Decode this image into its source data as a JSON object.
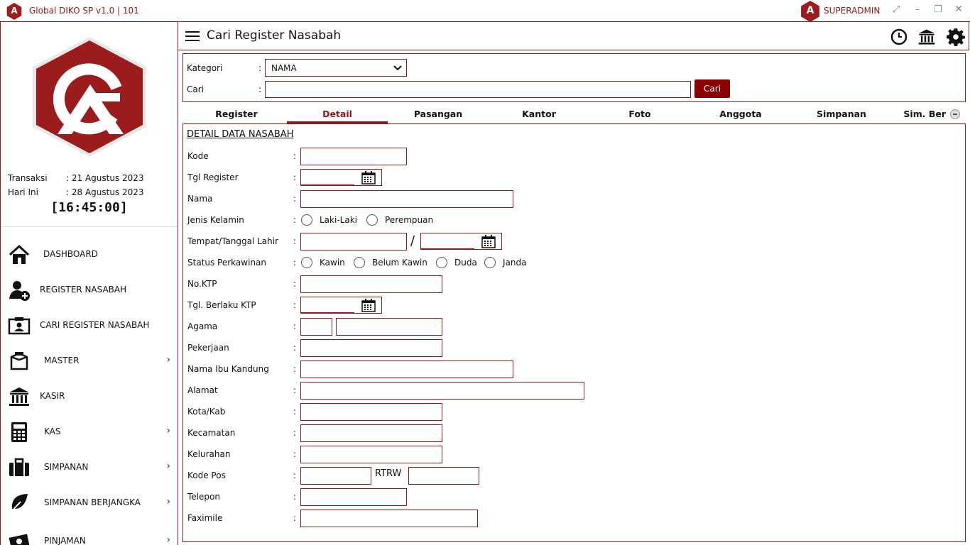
{
  "window": {
    "title": "Global DIKO SP v1.0 | 101",
    "user": "SUPERADMIN"
  },
  "sidebar": {
    "transaksi_label": "Transaksi",
    "transaksi_value": ": 21 Agustus 2023",
    "hari_ini_label": "Hari Ini",
    "hari_ini_value": ": 28 Agustus 2023",
    "clock": "[16:45:00]",
    "items": [
      {
        "label": "DASHBOARD",
        "icon": "home-icon"
      },
      {
        "label": "REGISTER NASABAH",
        "icon": "user-add-icon"
      },
      {
        "label": "CARI REGISTER NASABAH",
        "icon": "id-card-icon"
      },
      {
        "label": "MASTER",
        "icon": "box-icon"
      },
      {
        "label": "KASIR",
        "icon": "bank-icon"
      },
      {
        "label": "KAS",
        "icon": "calculator-icon"
      },
      {
        "label": "SIMPANAN",
        "icon": "briefcase-icon"
      },
      {
        "label": "SIMPANAN BERJANGKA",
        "icon": "leaf-icon"
      },
      {
        "label": "PINJAMAN",
        "icon": "money-icon"
      }
    ]
  },
  "header": {
    "title": "Cari Register Nasabah"
  },
  "search": {
    "kategori_label": "Kategori",
    "kategori_value": "NAMA",
    "cari_label": "Cari",
    "cari_value": "",
    "button": "Cari"
  },
  "tabs": [
    "Register",
    "Detail",
    "Pasangan",
    "Kantor",
    "Foto",
    "Anggota",
    "Simpanan",
    "Sim. Ber"
  ],
  "active_tab": "Detail",
  "detail": {
    "section_title": "DETAIL DATA NASABAH",
    "colon": ":",
    "slash": "/",
    "rtrw": "RTRW",
    "labels": {
      "kode": "Kode",
      "tgl_register": "Tgl Register",
      "nama": "Nama",
      "jenis_kelamin": "Jenis Kelamin",
      "tempat_tgl_lahir": "Tempat/Tanggal Lahir",
      "status_perkawinan": "Status Perkawinan",
      "no_ktp": "No.KTP",
      "tgl_berlaku_ktp": "Tgl. Berlaku KTP",
      "agama": "Agama",
      "pekerjaan": "Pekerjaan",
      "nama_ibu": "Nama Ibu Kandung",
      "alamat": "Alamat",
      "kota": "Kota/Kab",
      "kecamatan": "Kecamatan",
      "kelurahan": "Kelurahan",
      "kode_pos": "Kode Pos",
      "telepon": "Telepon",
      "faximile": "Faximile"
    },
    "gender_options": [
      "Laki-Laki",
      "Perempuan"
    ],
    "marital_options": [
      "Kawin",
      "Belum Kawin",
      "Duda",
      "Janda"
    ]
  },
  "colors": {
    "accent": "#8b1a1a",
    "button": "#8b0000"
  }
}
